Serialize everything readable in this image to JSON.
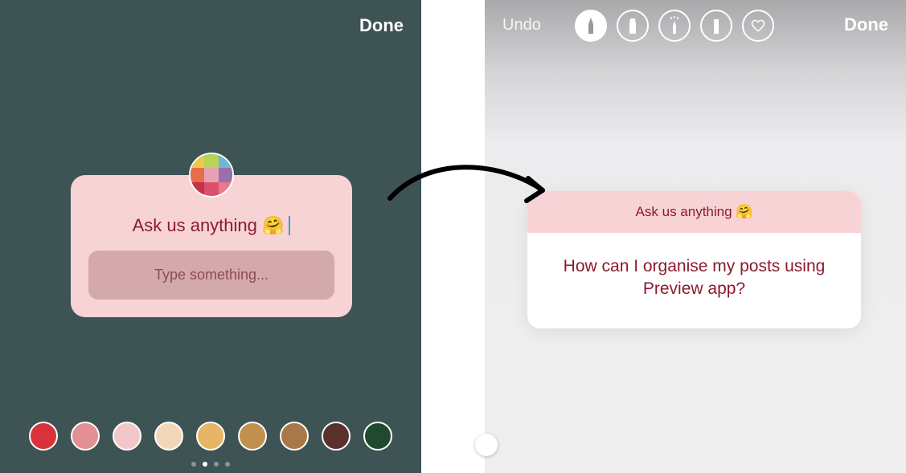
{
  "left": {
    "done_label": "Done",
    "prompt": "Ask us anything 🤗",
    "placeholder": "Type something...",
    "swatches": [
      "#d9323a",
      "#e39092",
      "#f3c6c9",
      "#f2d6b8",
      "#e6b565",
      "#c18f4e",
      "#a97848",
      "#5b312d",
      "#1f4a2e"
    ],
    "page_dots": 4,
    "active_dot": 1
  },
  "right": {
    "undo_label": "Undo",
    "done_label": "Done",
    "tools": [
      "pen",
      "marker",
      "neon",
      "eraser",
      "heart"
    ],
    "header": "Ask us anything 🤗",
    "answer": "How can I organise my posts using Preview app?"
  },
  "colors": {
    "left_bg": "#3e5353",
    "card_pink": "#f7d3d6",
    "text_maroon": "#8b1a2e"
  }
}
